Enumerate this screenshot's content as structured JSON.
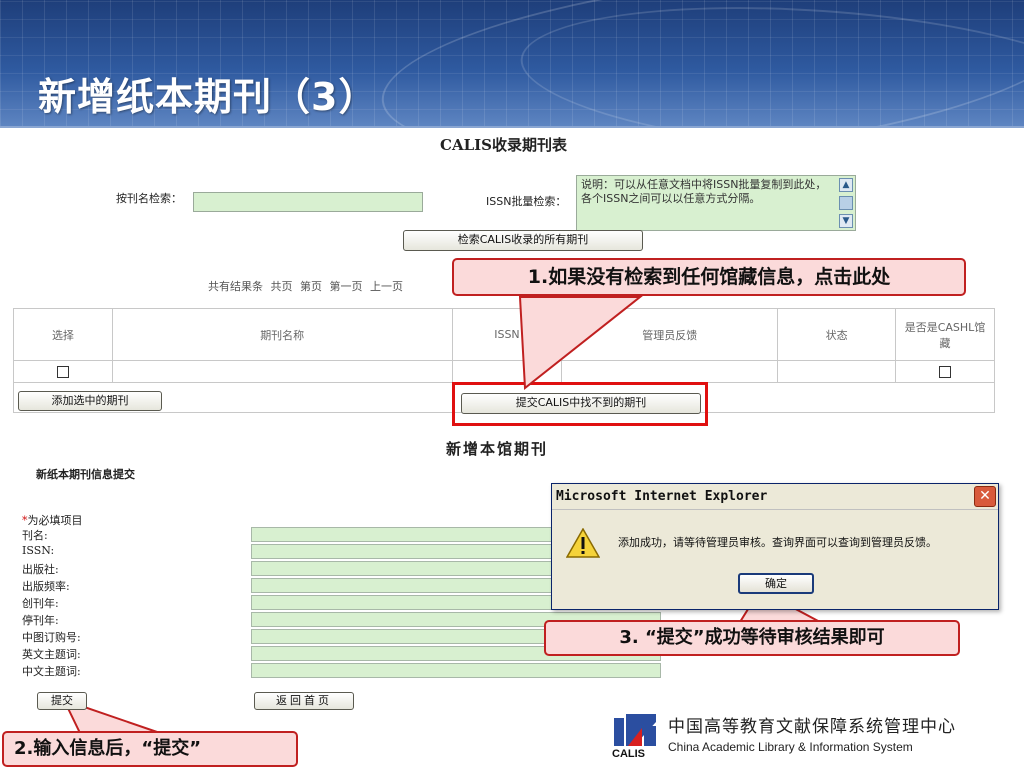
{
  "slide": {
    "title": "新增纸本期刊（3）"
  },
  "search_form": {
    "title": "CALIS收录期刊表",
    "title_search_label": "按刊名检索：",
    "issn_batch_label": "ISSN批量检索：",
    "issn_note": "说明：可以从任意文档中将ISSN批量复制到此处，各个ISSN之间可以以任意方式分隔。",
    "search_all_button": "检索CALIS收录的所有期刊"
  },
  "pager": {
    "text": "共有结果条  共页  第页  第一页  上一页"
  },
  "results_table": {
    "headers": [
      "选择",
      "期刊名称",
      "ISSN",
      "管理员反馈",
      "状态",
      "是否是CASHL馆藏"
    ],
    "add_selected_button": "添加选中的期刊",
    "submit_missing_button": "提交CALIS中找不到的期刊"
  },
  "new_form": {
    "section_title": "新增本馆期刊",
    "form_title": "新纸本期刊信息提交",
    "required_note": "为必填项目",
    "required_star": "*",
    "fields": [
      {
        "label": "刊名:"
      },
      {
        "label": "ISSN:"
      },
      {
        "label": "出版社:"
      },
      {
        "label": "出版频率:"
      },
      {
        "label": "创刊年:"
      },
      {
        "label": "停刊年:"
      },
      {
        "label": "中图订购号:"
      },
      {
        "label": "英文主题词:"
      },
      {
        "label": "中文主题词:"
      }
    ],
    "submit_button": "提交",
    "back_button": "返回首页"
  },
  "dialog": {
    "title": "Microsoft Internet Explorer",
    "message": "添加成功，请等待管理员审核。查询界面可以查询到管理员反馈。",
    "ok_button": "确定",
    "close_glyph": "✕",
    "icon": "warning-icon"
  },
  "callouts": {
    "step1": "1.如果没有检索到任何馆藏信息，点击此处",
    "step2": "2.输入信息后，“提交”",
    "step3": "3. “提交”成功等待审核结果即可"
  },
  "footer": {
    "logo_text": "CALIS",
    "org_cn": "中国高等教育文献保障系统管理中心",
    "org_en": "China Academic Library & Information System"
  },
  "colors": {
    "header_blue": "#2f5aa0",
    "input_green": "#d8f0d0",
    "callout_fill": "#fbdada",
    "callout_border": "#c02020",
    "highlight_red": "#e01010"
  }
}
